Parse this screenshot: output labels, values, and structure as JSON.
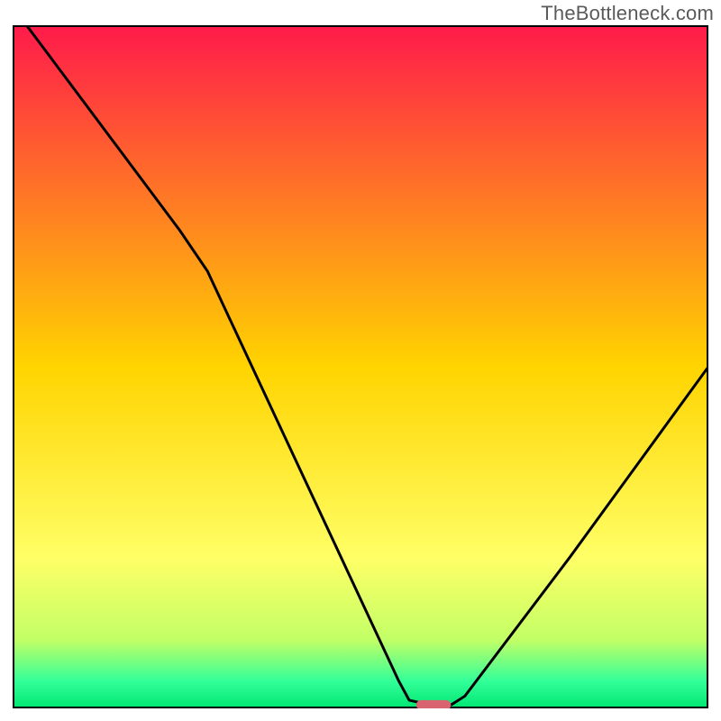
{
  "watermark": "TheBottleneck.com",
  "chart_data": {
    "type": "line",
    "title": "",
    "xlabel": "",
    "ylabel": "",
    "xlim": [
      0,
      100
    ],
    "ylim": [
      0,
      100
    ],
    "legend": null,
    "axes_visible": false,
    "gradient_bands": [
      {
        "position": 0.0,
        "color": "#ff1a4b"
      },
      {
        "position": 0.5,
        "color": "#ffd400"
      },
      {
        "position": 0.78,
        "color": "#ffff66"
      },
      {
        "position": 0.9,
        "color": "#c2ff66"
      },
      {
        "position": 0.96,
        "color": "#33ff99"
      },
      {
        "position": 1.0,
        "color": "#00e673"
      }
    ],
    "series": [
      {
        "name": "bottleneck-curve",
        "color": "#000000",
        "points": [
          {
            "x": 2.0,
            "y": 100.0
          },
          {
            "x": 24.0,
            "y": 70.0
          },
          {
            "x": 28.0,
            "y": 64.0
          },
          {
            "x": 55.5,
            "y": 4.0
          },
          {
            "x": 57.0,
            "y": 1.2
          },
          {
            "x": 60.0,
            "y": 0.5
          },
          {
            "x": 63.0,
            "y": 0.5
          },
          {
            "x": 65.0,
            "y": 1.8
          },
          {
            "x": 80.0,
            "y": 22.0
          },
          {
            "x": 100.0,
            "y": 50.0
          }
        ]
      }
    ],
    "marker": {
      "shape": "capsule",
      "x": 60.5,
      "y": 0.5,
      "width": 5.0,
      "height": 1.4,
      "fill": "#d9636e"
    }
  }
}
